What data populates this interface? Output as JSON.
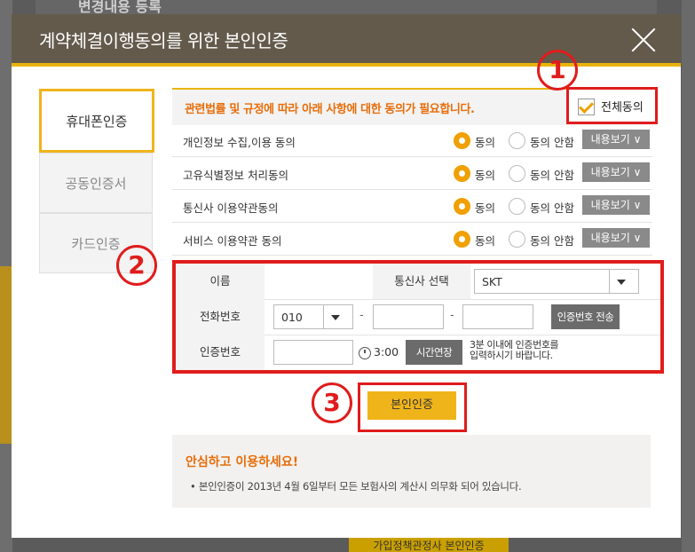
{
  "background": {
    "top_heading": "변경내용 등록",
    "bottom_button": "가입정책관정사 본인인증"
  },
  "modal": {
    "title": "계약체결이행동의를 위한 본인인증",
    "close_icon": "close-icon"
  },
  "tabs": [
    {
      "label": "휴대폰인증",
      "active": true
    },
    {
      "label": "공동인증서",
      "active": false
    },
    {
      "label": "카드인증",
      "active": false
    }
  ],
  "consent": {
    "header_text": "관련법률 및 규정에 따라 아래 사항에 대한 동의가 필요합니다.",
    "all_agree_label": "전체동의",
    "all_agree_checked": true,
    "agree_label": "동의",
    "disagree_label": "동의 안함",
    "view_label": "내용보기 ∨",
    "items": [
      {
        "label": "개인정보 수집,이용 동의",
        "selected": "agree"
      },
      {
        "label": "고유식별정보 처리동의",
        "selected": "agree"
      },
      {
        "label": "통신사 이용약관동의",
        "selected": "agree"
      },
      {
        "label": "서비스 이용약관 동의",
        "selected": "agree"
      }
    ]
  },
  "annotations": [
    "1",
    "2",
    "3"
  ],
  "form": {
    "name_label": "이름",
    "name_value": "",
    "carrier_label": "통신사 선택",
    "carrier_value": "SKT",
    "phone_label": "전화번호",
    "phone_prefix": "010",
    "phone_mid": "",
    "phone_last": "",
    "send_code_label": "인증번호 전송",
    "code_label": "인증번호",
    "code_value": "",
    "timer": "3:00",
    "extend_label": "시간연장",
    "note_line1": "3분 이내에 인증번호를",
    "note_line2": "입력하시기 바랍니다."
  },
  "verify_button": "본인인증",
  "info": {
    "title": "안심하고 이용하세요!",
    "text": "• 본인인증이 2013년 4월 6일부터 모든 보험사의 계산시 의무화 되어 있습니다."
  },
  "colors": {
    "header_bg": "#635a4c",
    "accent": "#f0b41b",
    "orange_text": "#e86d0a",
    "annotation_red": "#e01c1c"
  }
}
